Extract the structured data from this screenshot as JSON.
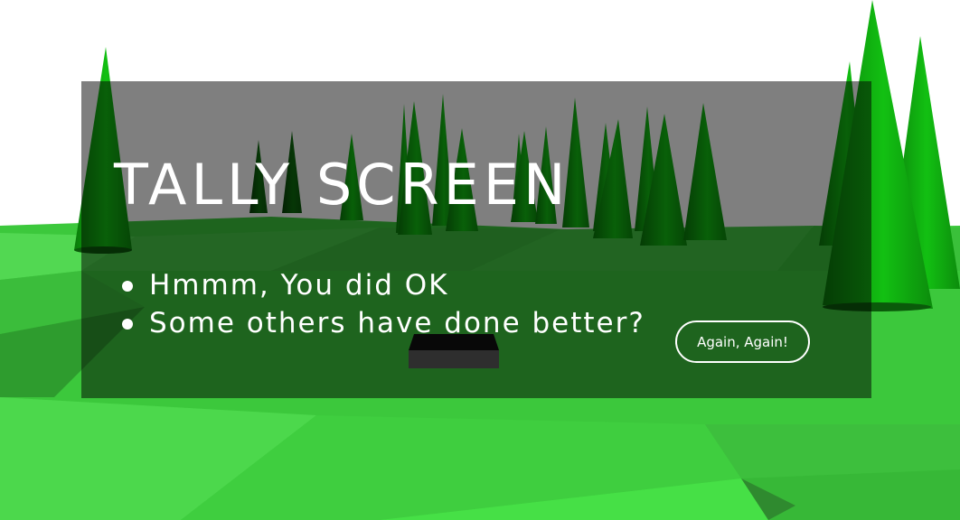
{
  "tally": {
    "title": "TALLY SCREEN",
    "results": [
      "Hmmm, You did OK",
      "Some others have done better?"
    ],
    "again_label": "Again, Again!"
  },
  "colors": {
    "sky": "#ffffff",
    "ground_light": "#3fe03f",
    "ground_dark": "#2a7a2a",
    "tree_bright": "#10b010",
    "tree_dark": "#0a6a0a",
    "overlay": "rgba(0,0,0,0.5)",
    "text": "#ffffff"
  },
  "icons": {
    "bullet": "disc-bullet-icon"
  }
}
